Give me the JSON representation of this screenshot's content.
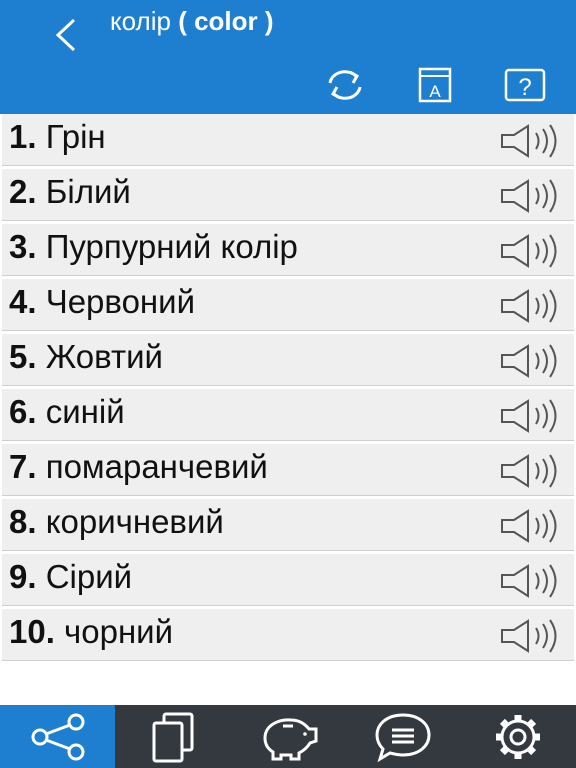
{
  "header": {
    "title_word": "колір",
    "title_translation": "( color )",
    "icons": [
      "back-chevron-icon",
      "refresh-icon",
      "dictionary-icon",
      "help-icon"
    ]
  },
  "items": [
    {
      "number": "1.",
      "word": "Грін"
    },
    {
      "number": "2.",
      "word": "Білий"
    },
    {
      "number": "3.",
      "word": "Пурпурний колір"
    },
    {
      "number": "4.",
      "word": "Червоний"
    },
    {
      "number": "5.",
      "word": "Жовтий"
    },
    {
      "number": "6.",
      "word": "синій"
    },
    {
      "number": "7.",
      "word": "помаранчевий"
    },
    {
      "number": "8.",
      "word": "коричневий"
    },
    {
      "number": "9.",
      "word": "Сірий"
    },
    {
      "number": "10.",
      "word": "чорний"
    }
  ],
  "tabbar": {
    "tabs": [
      "share-icon",
      "cards-icon",
      "piggy-bank-icon",
      "chat-icon",
      "settings-icon"
    ],
    "active_index": 0
  },
  "colors": {
    "accent": "#1e7fd0",
    "tabbar": "#34393f",
    "row": "#efefef"
  }
}
